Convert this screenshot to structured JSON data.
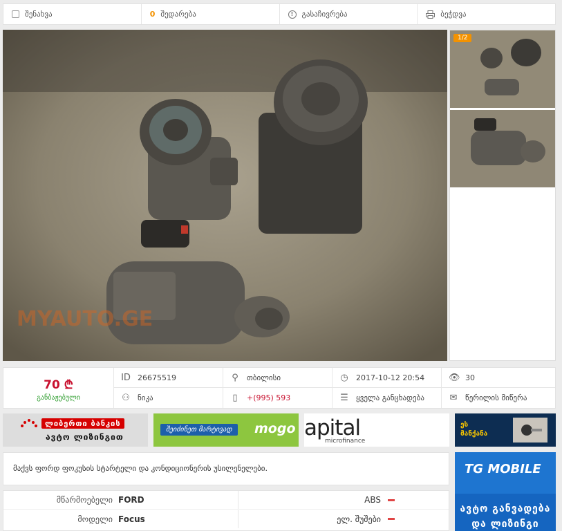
{
  "actions": {
    "save": "შენახვა",
    "compare_count": "0",
    "compare": "შედარება",
    "complain": "გასაჩივრება",
    "print": "ბეჭდვა"
  },
  "gallery": {
    "counter": "1/2",
    "watermark": "MYAUTO.GE"
  },
  "listing": {
    "price": "70 ₾",
    "price_note": "განბაჟებული",
    "id": "26675519",
    "location": "თბილისი",
    "date": "2017-10-12 20:54",
    "views": "30",
    "seller": "ნიკა",
    "phone": "+(995) 593",
    "all_listings": "ყველა განცხადება",
    "write_message": "წერილის მიწერა"
  },
  "banners": {
    "liberty_tag": "ლიბერთი ბანკის",
    "liberty_line": "ავტო ლიზინგით",
    "mogo_tag": "შეიძინეთ მარტივად",
    "mogo_logo": "mogo",
    "capital_logo": "apital",
    "capital_sub": "microfinance",
    "car_tag_1": "ეს",
    "car_tag_2": "მანქანა"
  },
  "description": "მაქვს ფორდ ფოკუსის სტარტელი და კონდიციონერის უსილენელები.",
  "specs": {
    "manufacturer_label": "მწარმოებელი",
    "manufacturer": "FORD",
    "model_label": "მოდელი",
    "model": "Focus",
    "abs_label": "ABS",
    "windows_label": "ელ. შუშები"
  },
  "tg_banner": {
    "logo": "TG MOBILE",
    "line1": "ავტო განვადება",
    "line2": "და ლიზინგი"
  },
  "colors": {
    "accent_orange": "#f39200",
    "price_red": "#c8102e",
    "note_green": "#2e9d2e"
  }
}
